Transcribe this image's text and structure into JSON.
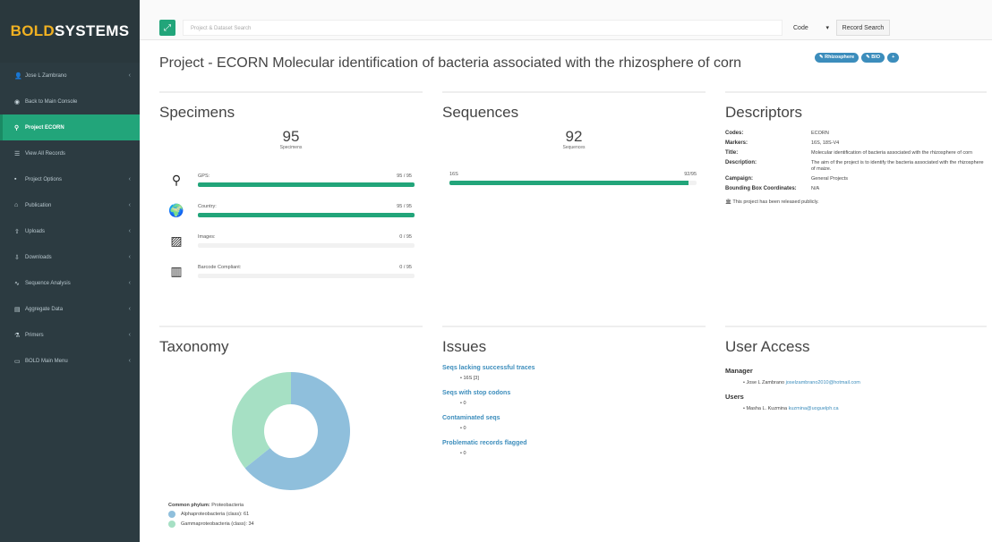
{
  "sidebar": {
    "logo_bold": "BOLD",
    "logo_systems": "SYSTEMS",
    "items": [
      {
        "icon": "user-icon",
        "glyph": "👤",
        "label": "Jose L Zambrano",
        "chevron": true,
        "active": false
      },
      {
        "icon": "dashboard-icon",
        "glyph": "◉",
        "label": "Back to Main Console",
        "chevron": false,
        "active": false
      },
      {
        "icon": "location-pin-icon",
        "glyph": "⚲",
        "label": "Project ECORN",
        "chevron": false,
        "active": true
      },
      {
        "icon": "list-icon",
        "glyph": "☰",
        "label": "View All Records",
        "chevron": false,
        "active": false
      },
      {
        "icon": "briefcase-icon",
        "glyph": "▪",
        "label": "Project Options",
        "chevron": true,
        "active": false
      },
      {
        "icon": "building-icon",
        "glyph": "⌂",
        "label": "Publication",
        "chevron": true,
        "active": false
      },
      {
        "icon": "upload-icon",
        "glyph": "⇧",
        "label": "Uploads",
        "chevron": true,
        "active": false
      },
      {
        "icon": "download-icon",
        "glyph": "⇩",
        "label": "Downloads",
        "chevron": true,
        "active": false
      },
      {
        "icon": "chart-icon",
        "glyph": "∿",
        "label": "Sequence Analysis",
        "chevron": true,
        "active": false
      },
      {
        "icon": "database-icon",
        "glyph": "▤",
        "label": "Aggregate Data",
        "chevron": true,
        "active": false
      },
      {
        "icon": "flask-icon",
        "glyph": "⚗",
        "label": "Primers",
        "chevron": true,
        "active": false
      },
      {
        "icon": "window-icon",
        "glyph": "▭",
        "label": "BOLD Main Menu",
        "chevron": true,
        "active": false
      }
    ]
  },
  "topbar": {
    "search_placeholder": "Project & Dataset Search",
    "code_label": "Code",
    "record_search_label": "Record Search"
  },
  "page": {
    "title": "Project - ECORN Molecular identification of bacteria associated with the rhizosphere of corn",
    "tags": [
      "Rhizosphere",
      "BIO",
      "+"
    ]
  },
  "specimens": {
    "heading": "Specimens",
    "count": "95",
    "count_label": "Specimens",
    "metrics": [
      {
        "icon": "map-marker-icon",
        "glyph": "⚲",
        "label": "GPS:",
        "value": "95 / 95",
        "fraction": 1.0
      },
      {
        "icon": "globe-icon",
        "glyph": "🌍",
        "label": "Country:",
        "value": "95 / 95",
        "fraction": 1.0
      },
      {
        "icon": "image-icon",
        "glyph": "▨",
        "label": "Images:",
        "value": "0 / 95",
        "fraction": 0.0
      },
      {
        "icon": "barcode-icon",
        "glyph": "▥",
        "label": "Barcode Compliant:",
        "value": "0 / 95",
        "fraction": 0.0
      }
    ]
  },
  "sequences": {
    "heading": "Sequences",
    "count": "92",
    "count_label": "Sequences",
    "marker": "16S",
    "value": "92/95",
    "fraction": 0.968
  },
  "descriptors": {
    "heading": "Descriptors",
    "rows": [
      {
        "k": "Codes:",
        "v": "ECORN"
      },
      {
        "k": "Markers:",
        "v": "16S, 18S-V4"
      },
      {
        "k": "Title:",
        "v": "Molecular identification of bacteria associated with the rhizosphere of corn"
      },
      {
        "k": "Description:",
        "v": "The aim of the project is to identify the bacteria associated with the rhizosphere of maize."
      },
      {
        "k": "Campaign:",
        "v": "General Projects"
      },
      {
        "k": "Bounding Box Coordinates:",
        "v": "N/A"
      }
    ],
    "released": "This project has been released publicly."
  },
  "taxonomy": {
    "heading": "Taxonomy",
    "common_label": "Common phylum:",
    "common_value": "Proteobacteria",
    "colors": {
      "alpha": "#8fbfdc",
      "gamma": "#a6e0c4"
    },
    "slices": [
      {
        "label": "Alphaproteobacteria (class): 61",
        "value": 61
      },
      {
        "label": "Gammaproteobacteria (class): 34",
        "value": 34
      }
    ]
  },
  "issues": {
    "heading": "Issues",
    "items": [
      {
        "label": "Seqs lacking successful traces",
        "value": "16S [3]"
      },
      {
        "label": "Seqs with stop codons",
        "value": "0"
      },
      {
        "label": "Contaminated seqs",
        "value": "0"
      },
      {
        "label": "Problematic records flagged",
        "value": "0"
      }
    ]
  },
  "useraccess": {
    "heading": "User Access",
    "manager_heading": "Manager",
    "manager_name": "Jose L Zambrano",
    "manager_email": "joselzambrano2010@hotmail.com",
    "users_heading": "Users",
    "user_name": "Masha L. Kuzmina",
    "user_email": "kuzmina@uoguelph.ca"
  }
}
